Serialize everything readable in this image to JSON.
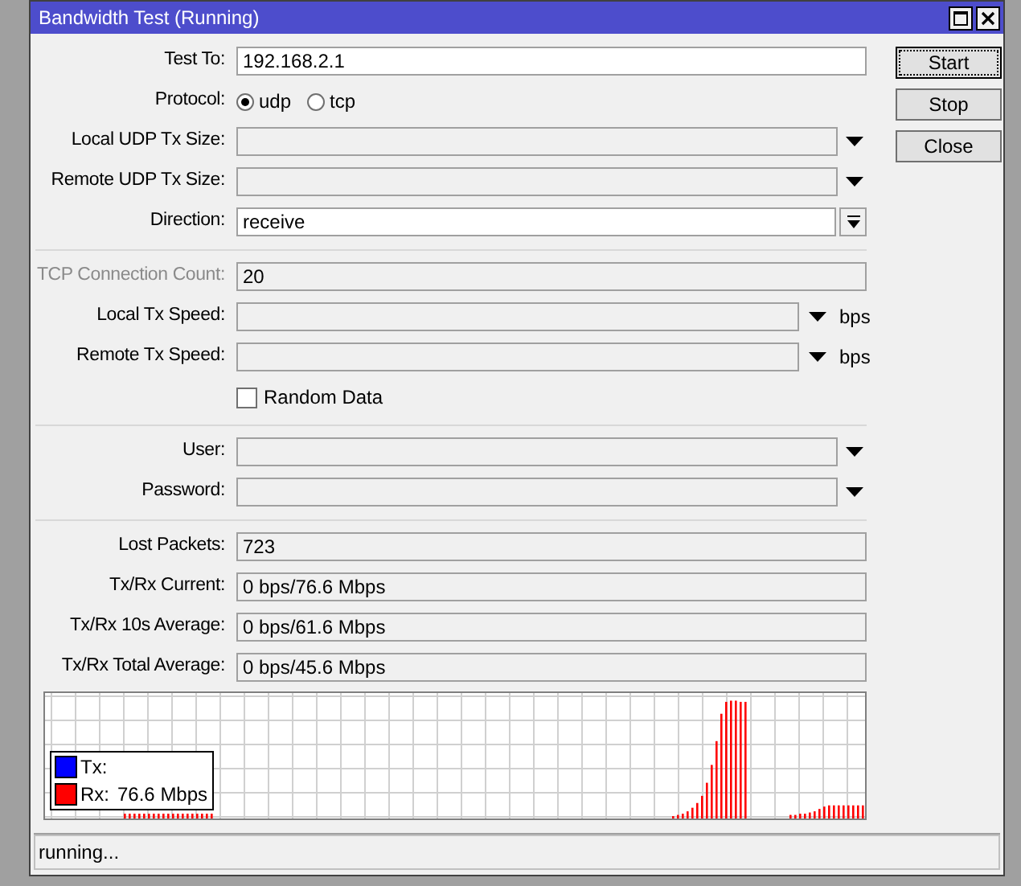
{
  "window": {
    "title": "Bandwidth Test (Running)"
  },
  "form": [
    {
      "kind": "text",
      "label": "Test To:",
      "value": "192.168.2.1",
      "disabled": false
    },
    {
      "kind": "radio",
      "label": "Protocol:",
      "options": [
        {
          "label": "udp",
          "selected": true
        },
        {
          "label": "tcp",
          "selected": false
        }
      ]
    },
    {
      "kind": "combo",
      "label": "Local UDP Tx Size:"
    },
    {
      "kind": "combo",
      "label": "Remote UDP Tx Size:"
    },
    {
      "kind": "select",
      "label": "Direction:",
      "value": "receive"
    },
    {
      "kind": "separator"
    },
    {
      "kind": "text",
      "label": "TCP Connection Count:",
      "value": "20",
      "disabled": true
    },
    {
      "kind": "speed",
      "label": "Local Tx Speed:",
      "unit": "bps"
    },
    {
      "kind": "speed",
      "label": "Remote Tx Speed:",
      "unit": "bps"
    },
    {
      "kind": "checkbox",
      "label": "Random Data",
      "checked": false
    },
    {
      "kind": "separator"
    },
    {
      "kind": "combo",
      "label": "User:"
    },
    {
      "kind": "combo",
      "label": "Password:"
    },
    {
      "kind": "separator"
    },
    {
      "kind": "output",
      "label": "Lost Packets:",
      "value": "723"
    },
    {
      "kind": "output",
      "label": "Tx/Rx Current:",
      "value": "0 bps/76.6 Mbps"
    },
    {
      "kind": "output",
      "label": "Tx/Rx 10s Average:",
      "value": "0 bps/61.6 Mbps"
    },
    {
      "kind": "output",
      "label": "Tx/Rx Total Average:",
      "value": "0 bps/45.6 Mbps"
    }
  ],
  "graph": {
    "legend": [
      {
        "label": "Tx:",
        "color": "#0000ff"
      },
      {
        "label": "Rx:",
        "value": "76.6 Mbps",
        "color": "#ff0000"
      }
    ]
  },
  "buttons": [
    {
      "label": "Start",
      "focused": true
    },
    {
      "label": "Stop",
      "focused": false
    },
    {
      "label": "Close",
      "focused": false
    }
  ],
  "status_bar": {
    "text": "running..."
  }
}
